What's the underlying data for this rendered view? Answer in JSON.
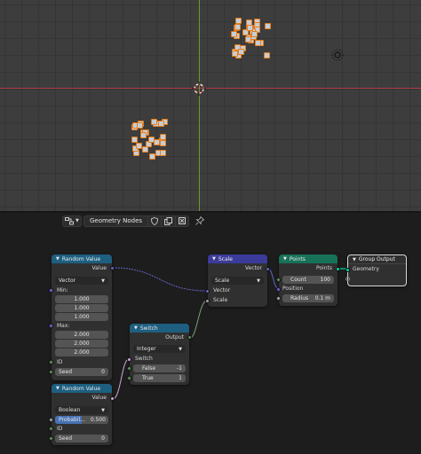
{
  "viewport": {
    "light_icon": "sun-light-icon",
    "origin_icon": "cursor-origin-icon"
  },
  "editor": {
    "tree_name": "Geometry Nodes",
    "icons": {
      "editor_type": "node-editor-type-icon",
      "shield": "fake-user-shield-icon",
      "copy": "duplicate-icon",
      "close": "close-icon",
      "pin": "pin-icon",
      "dropdown": "chevron-down-icon"
    }
  },
  "nodes": {
    "random_a": {
      "title": "Random Value",
      "out_value": "Value",
      "dtype": "Vector",
      "min_label": "Min:",
      "min": [
        "1.000",
        "1.000",
        "1.000"
      ],
      "max_label": "Max:",
      "max": [
        "2.000",
        "2.000",
        "2.000"
      ],
      "id_label": "ID",
      "seed_label": "Seed",
      "seed": "0"
    },
    "random_b": {
      "title": "Random Value",
      "out_value": "Value",
      "dtype": "Boolean",
      "prob_label": "Probabil...",
      "prob": "0.500",
      "id_label": "ID",
      "seed_label": "Seed",
      "seed": "0"
    },
    "switch": {
      "title": "Switch",
      "out_output": "Output",
      "dtype": "Integer",
      "switch_label": "Switch",
      "false_label": "False",
      "false_val": "-1",
      "true_label": "True",
      "true_val": "1"
    },
    "scale": {
      "title": "Scale",
      "out_vector": "Vector",
      "dtype": "Scale",
      "in_vector": "Vector",
      "in_scale": "Scale"
    },
    "points": {
      "title": "Points",
      "out_points": "Points",
      "count_label": "Count",
      "count": "100",
      "position_label": "Position",
      "radius_label": "Radius",
      "radius": "0.1 m"
    },
    "group_output": {
      "title": "Group Output",
      "geometry": "Geometry"
    }
  },
  "colors": {
    "func_header": "#1e5f80",
    "vector_header": "#3b3b9b",
    "geometry_header": "#187258",
    "selection": "#e87d19",
    "axis_x": "#b33d46",
    "axis_y": "#6a9a2a"
  }
}
